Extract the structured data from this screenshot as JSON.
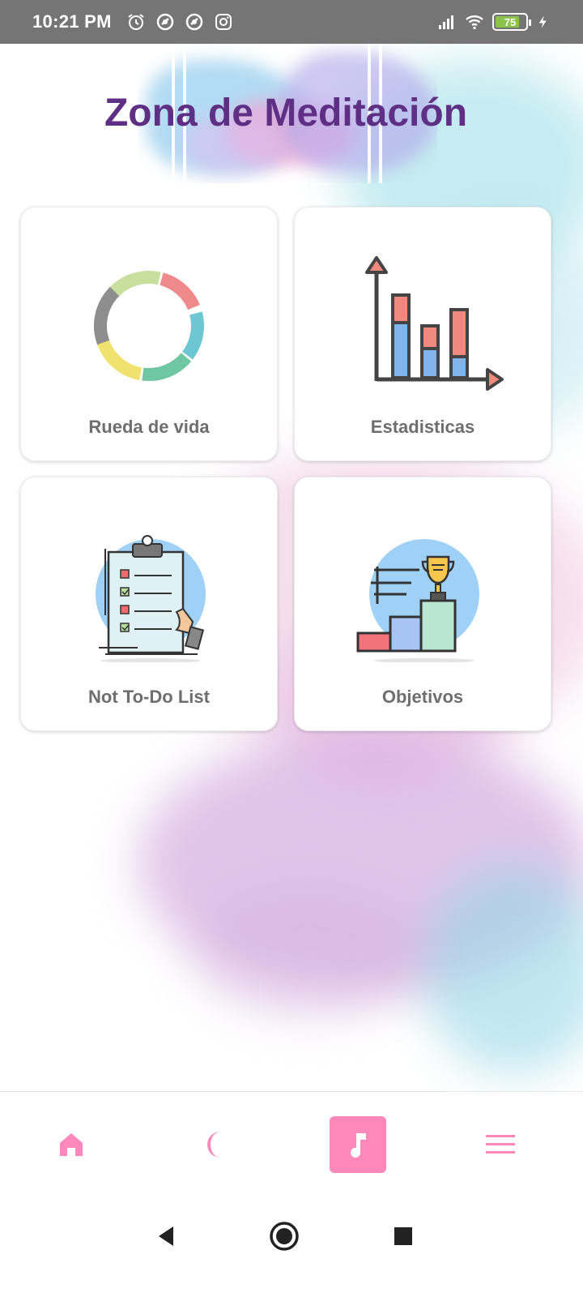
{
  "status_bar": {
    "time": "10:21 PM",
    "battery": "75",
    "left_icons": [
      "alarm-icon",
      "app-notification-icon",
      "app-notification-icon",
      "instagram-icon"
    ],
    "right_icons": [
      "signal-icon",
      "wifi-icon",
      "battery-icon",
      "charging-icon"
    ]
  },
  "header": {
    "title": "Zona de Meditación"
  },
  "cards": [
    {
      "label": "Rueda de vida",
      "icon": "life-wheel-icon"
    },
    {
      "label": "Estadisticas",
      "icon": "bar-chart-icon"
    },
    {
      "label": "Not To-Do List",
      "icon": "checklist-clipboard-icon"
    },
    {
      "label": "Objetivos",
      "icon": "trophy-podium-icon"
    }
  ],
  "bottom_nav": {
    "items": [
      {
        "icon": "home-icon",
        "active": false
      },
      {
        "icon": "moon-icon",
        "active": false
      },
      {
        "icon": "music-note-icon",
        "active": true
      },
      {
        "icon": "menu-icon",
        "active": false
      }
    ]
  },
  "colors": {
    "title": "#5e2f85",
    "accent_pink": "#ff88bb",
    "card_label": "#6e6e6e",
    "status_bar": "#757575"
  }
}
